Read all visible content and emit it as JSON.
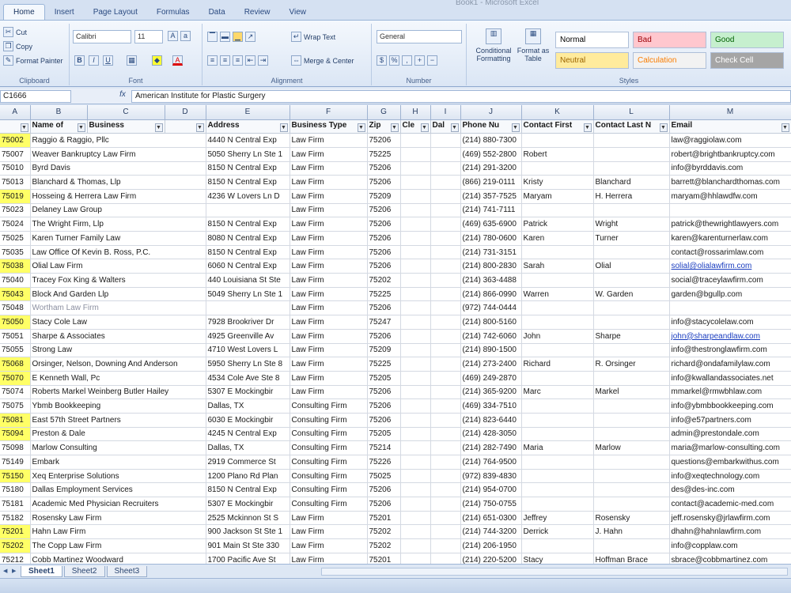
{
  "app": {
    "window_title": "Book1 - Microsoft Excel"
  },
  "ribbon": {
    "tabs": [
      "Home",
      "Insert",
      "Page Layout",
      "Formulas",
      "Data",
      "Review",
      "View"
    ],
    "clipboard": {
      "cut": "Cut",
      "copy": "Copy",
      "format_painter": "Format Painter",
      "label": "Clipboard"
    },
    "font": {
      "name": "Calibri",
      "size": "11",
      "label": "Font"
    },
    "alignment": {
      "wrap": "Wrap Text",
      "merge": "Merge & Center",
      "label": "Alignment"
    },
    "number": {
      "format": "General",
      "label": "Number"
    },
    "styles": {
      "conditional": "Conditional Formatting",
      "format_table": "Format as Table",
      "label": "Styles",
      "cells": [
        {
          "text": "Normal",
          "bg": "#ffffff",
          "fg": "#000000"
        },
        {
          "text": "Bad",
          "bg": "#ffc7ce",
          "fg": "#9c0006"
        },
        {
          "text": "Good",
          "bg": "#c6efce",
          "fg": "#006100"
        },
        {
          "text": "Neutral",
          "bg": "#ffeb9c",
          "fg": "#9c6500"
        },
        {
          "text": "Calculation",
          "bg": "#f2f2f2",
          "fg": "#fa7d00"
        },
        {
          "text": "Check Cell",
          "bg": "#a5a5a5",
          "fg": "#ffffff"
        }
      ]
    }
  },
  "formula_bar": {
    "name_box": "C1666",
    "fx": "fx",
    "content": "American Institute for Plastic Surgery"
  },
  "grid": {
    "columns": [
      "A",
      "B",
      "C",
      "D",
      "E",
      "F",
      "G",
      "H",
      "I",
      "J",
      "K",
      "L",
      "M"
    ],
    "header_row": [
      "",
      "Name of",
      "Business",
      "",
      "Address",
      "Business Type",
      "Zip",
      "Cle",
      "Dal",
      "Phone Nu",
      "Contact First",
      "Contact Last N",
      "Email"
    ],
    "rows": [
      {
        "id": "75002",
        "hl": true,
        "name": "Raggio & Raggio, Pllc",
        "addr": "4440 N Central Exp",
        "type": "Law Firm",
        "zip": "75206",
        "phone": "(214) 880-7300",
        "first": "",
        "last": "",
        "email": "law@raggiolaw.com"
      },
      {
        "id": "75007",
        "hl": false,
        "name": "Weaver Bankruptcy Law Firm",
        "addr": "5050 Sherry Ln Ste 1",
        "type": "Law Firm",
        "zip": "75225",
        "phone": "(469) 552-2800",
        "first": "Robert",
        "last": "",
        "email": "robert@brightbankruptcy.com"
      },
      {
        "id": "75010",
        "hl": false,
        "name": "Byrd Davis",
        "addr": "8150 N Central Exp",
        "type": "Law Firm",
        "zip": "75206",
        "phone": "(214) 291-3200",
        "first": "",
        "last": "",
        "email": "info@byrddavis.com"
      },
      {
        "id": "75013",
        "hl": false,
        "name": "Blanchard & Thomas, Llp",
        "addr": "8150 N Central Exp",
        "type": "Law Firm",
        "zip": "75206",
        "phone": "(866) 219-0111",
        "first": "Kristy",
        "last": "Blanchard",
        "email": "barrett@blanchardthomas.com"
      },
      {
        "id": "75019",
        "hl": true,
        "name": "Hosseing & Herrera Law Firm",
        "addr": "4236 W Lovers Ln D",
        "type": "Law Firm",
        "zip": "75209",
        "phone": "(214) 357-7525",
        "first": "Maryam",
        "last": "H. Herrera",
        "email": "maryam@hhlawdfw.com"
      },
      {
        "id": "75023",
        "hl": false,
        "name": "Delaney Law Group",
        "addr": "",
        "type": "Law Firm",
        "zip": "75206",
        "phone": "(214) 741-7111",
        "first": "",
        "last": "",
        "email": ""
      },
      {
        "id": "75024",
        "hl": false,
        "name": "The Wright Firm, Llp",
        "addr": "8150 N Central Exp",
        "type": "Law Firm",
        "zip": "75206",
        "phone": "(469) 635-6900",
        "first": "Patrick",
        "last": "Wright",
        "email": "patrick@thewrightlawyers.com"
      },
      {
        "id": "75025",
        "hl": false,
        "name": "Karen Turner Family Law",
        "addr": "8080 N Central Exp",
        "type": "Law Firm",
        "zip": "75206",
        "phone": "(214) 780-0600",
        "first": "Karen",
        "last": "Turner",
        "email": "karen@karenturnerlaw.com"
      },
      {
        "id": "75035",
        "hl": false,
        "name": "Law Office Of Kevin B. Ross, P.C.",
        "addr": "8150 N Central Exp",
        "type": "Law Firm",
        "zip": "75206",
        "phone": "(214) 731-3151",
        "first": "",
        "last": "",
        "email": "contact@rossarimlaw.com"
      },
      {
        "id": "75038",
        "hl": true,
        "name": "Olial Law Firm",
        "addr": "6060 N Central Exp",
        "type": "Law Firm",
        "zip": "75206",
        "phone": "(214) 800-2830",
        "first": "Sarah",
        "last": "Olial",
        "email": "solial@olialawfirm.com",
        "email_link": true
      },
      {
        "id": "75040",
        "hl": false,
        "name": "Tracey Fox King & Walters",
        "addr": "440 Louisiana St Ste",
        "type": "Law Firm",
        "zip": "75202",
        "phone": "(214) 363-4488",
        "first": "",
        "last": "",
        "email": "social@traceylawfirm.com"
      },
      {
        "id": "75043",
        "hl": true,
        "name": "Block And Garden Llp",
        "addr": "5049 Sherry Ln Ste 1",
        "type": "Law Firm",
        "zip": "75225",
        "phone": "(214) 866-0990",
        "first": "Warren",
        "last": "W. Garden",
        "email": "garden@bgullp.com"
      },
      {
        "id": "75048",
        "hl": false,
        "name": "Wortham Law Firm",
        "addr": "",
        "type": "Law Firm",
        "zip": "75206",
        "phone": "(972) 744-0444",
        "first": "",
        "last": "",
        "email": "",
        "fade": true
      },
      {
        "id": "75050",
        "hl": true,
        "name": "Stacy Cole Law",
        "addr": "7928 Brookriver Dr",
        "type": "Law Firm",
        "zip": "75247",
        "phone": "(214) 800-5160",
        "first": "",
        "last": "",
        "email": "info@stacycolelaw.com"
      },
      {
        "id": "75051",
        "hl": false,
        "name": "Sharpe & Associates",
        "addr": "4925 Greenville Av",
        "type": "Law Firm",
        "zip": "75206",
        "phone": "(214) 742-6060",
        "first": "John",
        "last": "Sharpe",
        "email": "john@sharpeandlaw.com",
        "email_link": true
      },
      {
        "id": "75055",
        "hl": false,
        "name": "Strong Law",
        "addr": "4710 West Lovers L",
        "type": "Law Firm",
        "zip": "75209",
        "phone": "(214) 890-1500",
        "first": "",
        "last": "",
        "email": "info@thestronglawfirm.com"
      },
      {
        "id": "75068",
        "hl": true,
        "name": "Orsinger, Nelson, Downing And Anderson",
        "addr": "5950 Sherry Ln Ste 8",
        "type": "Law Firm",
        "zip": "75225",
        "phone": "(214) 273-2400",
        "first": "Richard",
        "last": "R. Orsinger",
        "email": "richard@ondafamilylaw.com"
      },
      {
        "id": "75070",
        "hl": true,
        "name": "E Kenneth Wall, Pc",
        "addr": "4534 Cole Ave Ste 8",
        "type": "Law Firm",
        "zip": "75205",
        "phone": "(469) 249-2870",
        "first": "",
        "last": "",
        "email": "info@kwallandassociates.net"
      },
      {
        "id": "75074",
        "hl": false,
        "name": "Roberts Markel Weinberg Butler Hailey",
        "addr": "5307 E Mockingbir",
        "type": "Law Firm",
        "zip": "75206",
        "phone": "(214) 365-9200",
        "first": "Marc",
        "last": "Markel",
        "email": "mmarkel@rmwbhlaw.com"
      },
      {
        "id": "75075",
        "hl": false,
        "name": "Ybmb Bookkeeping",
        "addr": "Dallas, TX",
        "type": "Consulting Firm",
        "zip": "75206",
        "phone": "(469) 334-7510",
        "first": "",
        "last": "",
        "email": "info@ybmbbookkeeping.com"
      },
      {
        "id": "75081",
        "hl": true,
        "name": "East 57th Street Partners",
        "addr": "6030 E Mockingbir",
        "type": "Consulting Firm",
        "zip": "75206",
        "phone": "(214) 823-6440",
        "first": "",
        "last": "",
        "email": "info@e57partners.com"
      },
      {
        "id": "75094",
        "hl": true,
        "name": "Preston & Dale",
        "addr": "4245 N Central Exp",
        "type": "Consulting Firm",
        "zip": "75205",
        "phone": "(214) 428-3050",
        "first": "",
        "last": "",
        "email": "admin@prestondale.com"
      },
      {
        "id": "75098",
        "hl": false,
        "name": "Marlow Consulting",
        "addr": "Dallas, TX",
        "type": "Consulting Firm",
        "zip": "75214",
        "phone": "(214) 282-7490",
        "first": "Maria",
        "last": "Marlow",
        "email": "maria@marlow-consulting.com"
      },
      {
        "id": "75149",
        "hl": false,
        "name": "Embark",
        "addr": "2919 Commerce St",
        "type": "Consulting Firm",
        "zip": "75226",
        "phone": "(214) 764-9500",
        "first": "",
        "last": "",
        "email": "questions@embarkwithus.com"
      },
      {
        "id": "75150",
        "hl": true,
        "name": "Xeq Enterprise Solutions",
        "addr": "1200 Plano Rd Plan",
        "type": "Consulting Firm",
        "zip": "75025",
        "phone": "(972) 839-4830",
        "first": "",
        "last": "",
        "email": "info@xeqtechnology.com"
      },
      {
        "id": "75180",
        "hl": false,
        "name": "Dallas Employment Services",
        "addr": "8150 N Central Exp",
        "type": "Consulting Firm",
        "zip": "75206",
        "phone": "(214) 954-0700",
        "first": "",
        "last": "",
        "email": "des@des-inc.com"
      },
      {
        "id": "75181",
        "hl": false,
        "name": "Academic Med Physician Recruiters",
        "addr": "5307 E Mockingbir",
        "type": "Consulting Firm",
        "zip": "75206",
        "phone": "(214) 750-0755",
        "first": "",
        "last": "",
        "email": "contact@academic-med.com"
      },
      {
        "id": "75182",
        "hl": false,
        "name": "Rosensky Law Firm",
        "addr": "2525 Mckinnon St S",
        "type": "Law Firm",
        "zip": "75201",
        "phone": "(214) 651-0300",
        "first": "Jeffrey",
        "last": "Rosensky",
        "email": "jeff.rosensky@jrlawfirm.com"
      },
      {
        "id": "75201",
        "hl": true,
        "name": "Hahn Law Firm",
        "addr": "900 Jackson St Ste 1",
        "type": "Law Firm",
        "zip": "75202",
        "phone": "(214) 744-3200",
        "first": "Derrick",
        "last": "J. Hahn",
        "email": "dhahn@hahnlawfirm.com"
      },
      {
        "id": "75202",
        "hl": true,
        "name": "The Copp Law Firm",
        "addr": "901 Main St Ste 330",
        "type": "Law Firm",
        "zip": "75202",
        "phone": "(214) 206-1950",
        "first": "",
        "last": "",
        "email": "info@copplaw.com"
      },
      {
        "id": "75212",
        "hl": false,
        "name": "Cobb Martinez Woodward",
        "addr": "1700 Pacific Ave St",
        "type": "Law Firm",
        "zip": "75201",
        "phone": "(214) 220-5200",
        "first": "Stacy",
        "last": "Hoffman Brace",
        "email": "sbrace@cobbmartinez.com"
      }
    ]
  },
  "sheets": [
    "Sheet1",
    "Sheet2",
    "Sheet3"
  ]
}
